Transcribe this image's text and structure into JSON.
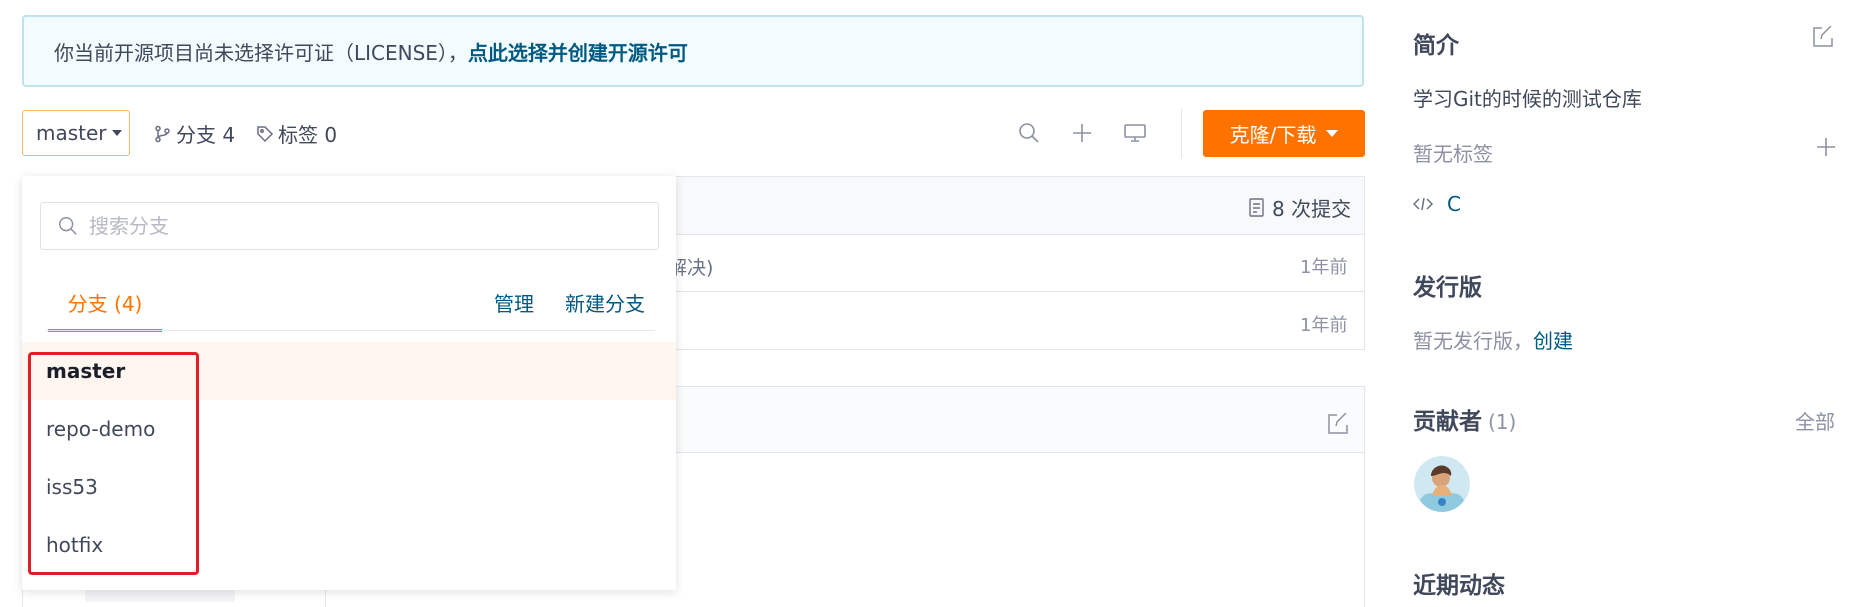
{
  "notice": {
    "message": "你当前开源项目尚未选择许可证（LICENSE），",
    "link": "点此选择并创建开源许可"
  },
  "toolbar": {
    "branch": "master",
    "branches_label": "分支 4",
    "tags_label": "标签 0",
    "clone_label": "克隆/下载",
    "icons": [
      "search-icon",
      "plus-icon",
      "monitor-icon"
    ]
  },
  "panel": {
    "commits": "8 次提交",
    "row1_fragment": "解决)",
    "row1_time": "1年前",
    "row2_time": "1年前"
  },
  "dropdown": {
    "search_placeholder": "搜索分支",
    "tab_label": "分支 (4)",
    "manage": "管理",
    "new_branch": "新建分支",
    "branches": [
      "master",
      "repo-demo",
      "iss53",
      "hotfix"
    ],
    "active_branch": "master"
  },
  "sidebar": {
    "intro_title": "简介",
    "description": "学习Git的时候的测试仓库",
    "no_tags": "暂无标签",
    "language": "C",
    "release_title": "发行版",
    "no_release": "暂无发行版，",
    "create": "创建",
    "contributors_title": "贡献者",
    "contributors_count": "(1)",
    "all": "全部",
    "activity_title": "近期动态"
  },
  "colors": {
    "accent": "#fe7300",
    "link": "#005980",
    "highlight": "#e01e26"
  }
}
